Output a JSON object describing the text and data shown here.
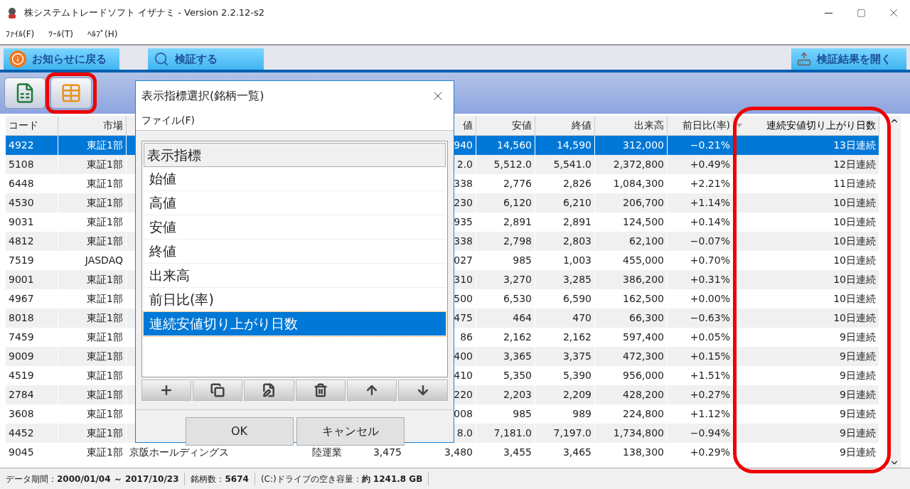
{
  "window": {
    "title": "株システムトレードソフト イザナミ - Version 2.2.12-s2"
  },
  "menu": [
    "ﾌｧｲﾙ(F)",
    "ﾂｰﾙ(T)",
    "ﾍﾙﾌﾟ(H)"
  ],
  "nav_tabs": [
    {
      "label": "お知らせに戻る",
      "kind": "info"
    },
    {
      "label": "検証する",
      "kind": "search"
    }
  ],
  "open_results_button": "検証結果を開く",
  "toolbar": [
    {
      "kind": "csv",
      "highlighted": false
    },
    {
      "kind": "table",
      "highlighted": true
    }
  ],
  "table": {
    "columns": [
      {
        "kind": "code",
        "label": "コード",
        "sorted": false,
        "highlighted": false
      },
      {
        "kind": "market",
        "label": "市場",
        "sorted": false,
        "highlighted": false
      },
      {
        "kind": "high",
        "label": "値",
        "sorted": false,
        "highlighted": false
      },
      {
        "kind": "low",
        "label": "安値",
        "sorted": false,
        "highlighted": false
      },
      {
        "kind": "close",
        "label": "終値",
        "sorted": false,
        "highlighted": false
      },
      {
        "kind": "volume",
        "label": "出来高",
        "sorted": false,
        "highlighted": false
      },
      {
        "kind": "change",
        "label": "前日比(率)",
        "sorted": false,
        "highlighted": false
      },
      {
        "kind": "streak",
        "label": "連続安値切り上がり日数",
        "sorted": true,
        "highlighted": true
      }
    ],
    "rows": [
      {
        "code": "4922",
        "market": "東証1部",
        "high": "940",
        "low": "14,560",
        "close": "14,590",
        "volume": "312,000",
        "change": "−0.21%",
        "streak": "13日連続",
        "selected": true
      },
      {
        "code": "5108",
        "market": "東証1部",
        "high": "2.0",
        "low": "5,512.0",
        "close": "5,541.0",
        "volume": "2,372,800",
        "change": "+0.49%",
        "streak": "12日連続",
        "selected": false
      },
      {
        "code": "6448",
        "market": "東証1部",
        "high": "338",
        "low": "2,776",
        "close": "2,826",
        "volume": "1,084,300",
        "change": "+2.21%",
        "streak": "11日連続",
        "selected": false
      },
      {
        "code": "4530",
        "market": "東証1部",
        "high": "230",
        "low": "6,120",
        "close": "6,210",
        "volume": "206,700",
        "change": "+1.14%",
        "streak": "10日連続",
        "selected": false
      },
      {
        "code": "9031",
        "market": "東証1部",
        "high": "935",
        "low": "2,891",
        "close": "2,891",
        "volume": "124,500",
        "change": "+0.14%",
        "streak": "10日連続",
        "selected": false
      },
      {
        "code": "4812",
        "market": "東証1部",
        "high": "338",
        "low": "2,798",
        "close": "2,803",
        "volume": "62,100",
        "change": "−0.07%",
        "streak": "10日連続",
        "selected": false
      },
      {
        "code": "7519",
        "market": "JASDAQ",
        "high": "027",
        "low": "985",
        "close": "1,003",
        "volume": "455,000",
        "change": "+0.70%",
        "streak": "10日連続",
        "selected": false
      },
      {
        "code": "9001",
        "market": "東証1部",
        "high": "310",
        "low": "3,270",
        "close": "3,285",
        "volume": "386,200",
        "change": "+0.31%",
        "streak": "10日連続",
        "selected": false
      },
      {
        "code": "4967",
        "market": "東証1部",
        "high": "500",
        "low": "6,530",
        "close": "6,590",
        "volume": "162,500",
        "change": "+0.00%",
        "streak": "10日連続",
        "selected": false
      },
      {
        "code": "8018",
        "market": "東証1部",
        "high": "475",
        "low": "464",
        "close": "470",
        "volume": "66,300",
        "change": "−0.63%",
        "streak": "10日連続",
        "selected": false
      },
      {
        "code": "7459",
        "market": "東証1部",
        "high": "86",
        "low": "2,162",
        "close": "2,162",
        "volume": "597,400",
        "change": "+0.05%",
        "streak": "9日連続",
        "selected": false
      },
      {
        "code": "9009",
        "market": "東証1部",
        "high": "400",
        "low": "3,365",
        "close": "3,375",
        "volume": "472,300",
        "change": "+0.15%",
        "streak": "9日連続",
        "selected": false
      },
      {
        "code": "4519",
        "market": "東証1部",
        "high": "410",
        "low": "5,350",
        "close": "5,390",
        "volume": "956,000",
        "change": "+1.51%",
        "streak": "9日連続",
        "selected": false
      },
      {
        "code": "2784",
        "market": "東証1部",
        "high": "220",
        "low": "2,203",
        "close": "2,209",
        "volume": "428,200",
        "change": "+0.27%",
        "streak": "9日連続",
        "selected": false
      },
      {
        "code": "3608",
        "market": "東証1部",
        "high": "008",
        "low": "985",
        "close": "989",
        "volume": "224,800",
        "change": "+1.12%",
        "streak": "9日連続",
        "selected": false
      },
      {
        "code": "4452",
        "market": "東証1部",
        "high": "8.0",
        "low": "7,181.0",
        "close": "7,197.0",
        "volume": "1,734,800",
        "change": "−0.94%",
        "streak": "9日連続",
        "selected": false
      },
      {
        "code": "9045",
        "market": "東証1部",
        "name": "京阪ホールディングス",
        "sector": "陸運業",
        "open": "3,475",
        "high": "3,480",
        "low": "3,455",
        "close": "3,465",
        "volume": "138,300",
        "change": "+0.29%",
        "streak": "9日連続",
        "selected": false
      }
    ]
  },
  "dialog": {
    "title": "表示指標選択(銘柄一覧)",
    "menu": "ファイル(F)",
    "list_header": "表示指標",
    "items": [
      {
        "label": "始値",
        "selected": false
      },
      {
        "label": "高値",
        "selected": false
      },
      {
        "label": "安値",
        "selected": false
      },
      {
        "label": "終値",
        "selected": false
      },
      {
        "label": "出来高",
        "selected": false
      },
      {
        "label": "前日比(率)",
        "selected": false
      },
      {
        "label": "連続安値切り上がり日数",
        "selected": true
      }
    ],
    "tools": [
      {
        "kind": "add"
      },
      {
        "kind": "copy"
      },
      {
        "kind": "edit"
      },
      {
        "kind": "delete"
      },
      {
        "kind": "up"
      },
      {
        "kind": "down"
      }
    ],
    "buttons": [
      "OK",
      "キャンセル"
    ]
  },
  "status_bar": [
    "データ期間：**2000/01/04 ～ 2017/10/23**",
    "銘柄数：**5674**",
    "(C:)ドライブの空き容量：**約 1241.8 GB**"
  ]
}
